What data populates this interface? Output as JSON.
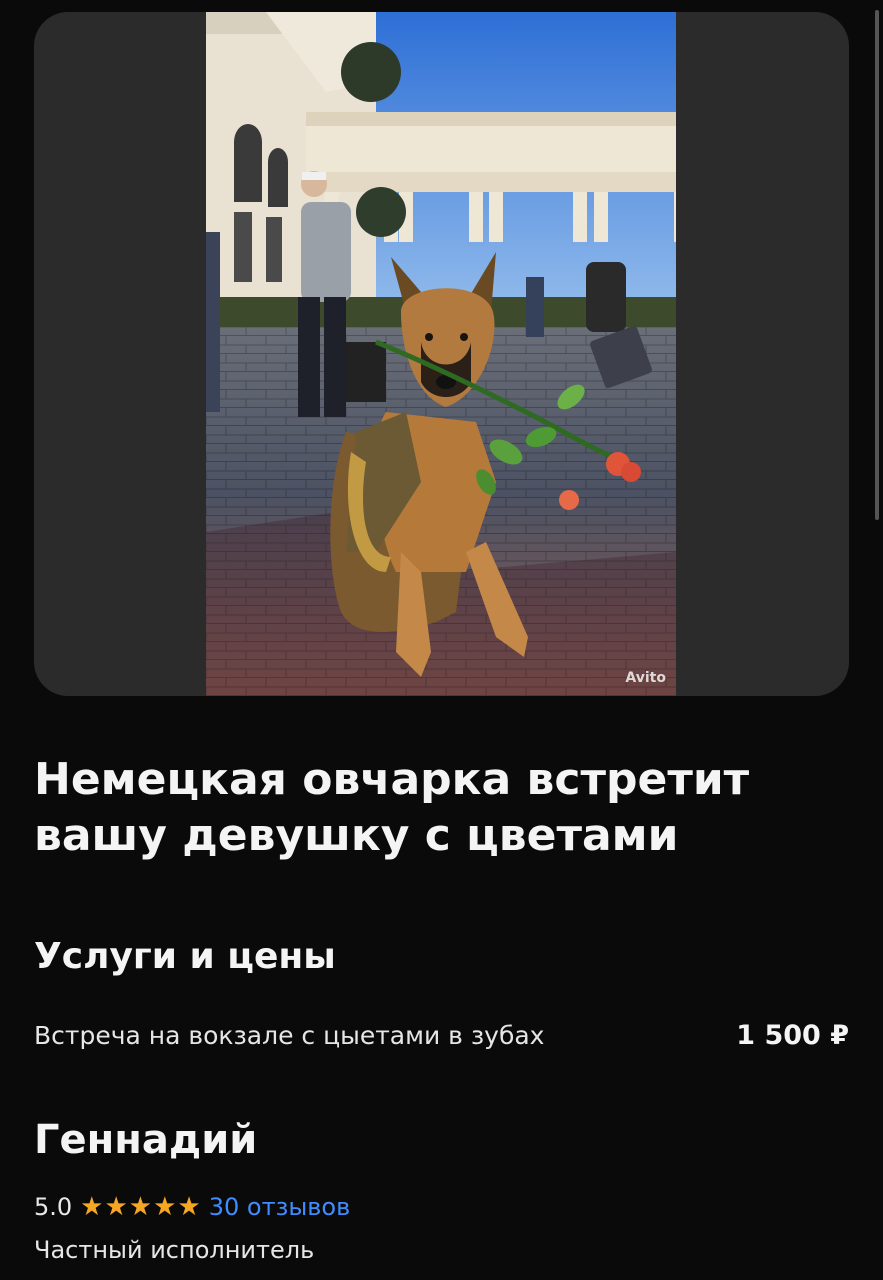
{
  "gallery": {
    "watermark": "Avito"
  },
  "listing": {
    "title": "Немецкая овчарка встретит вашу девушку с цветами"
  },
  "services": {
    "heading": "Услуги и цены",
    "items": [
      {
        "name": "Встреча на вокзале с цыетами в зубах",
        "price": "1 500 ₽"
      }
    ]
  },
  "seller": {
    "name": "Геннадий",
    "rating": "5.0",
    "stars": 5,
    "reviews": "30 отзывов",
    "type": "Частный исполнитель"
  },
  "colors": {
    "accent_link": "#3f8cff",
    "star": "#f5a623",
    "background": "#0a0a0a"
  },
  "icons": [
    "star-icon",
    "avito-logo"
  ]
}
